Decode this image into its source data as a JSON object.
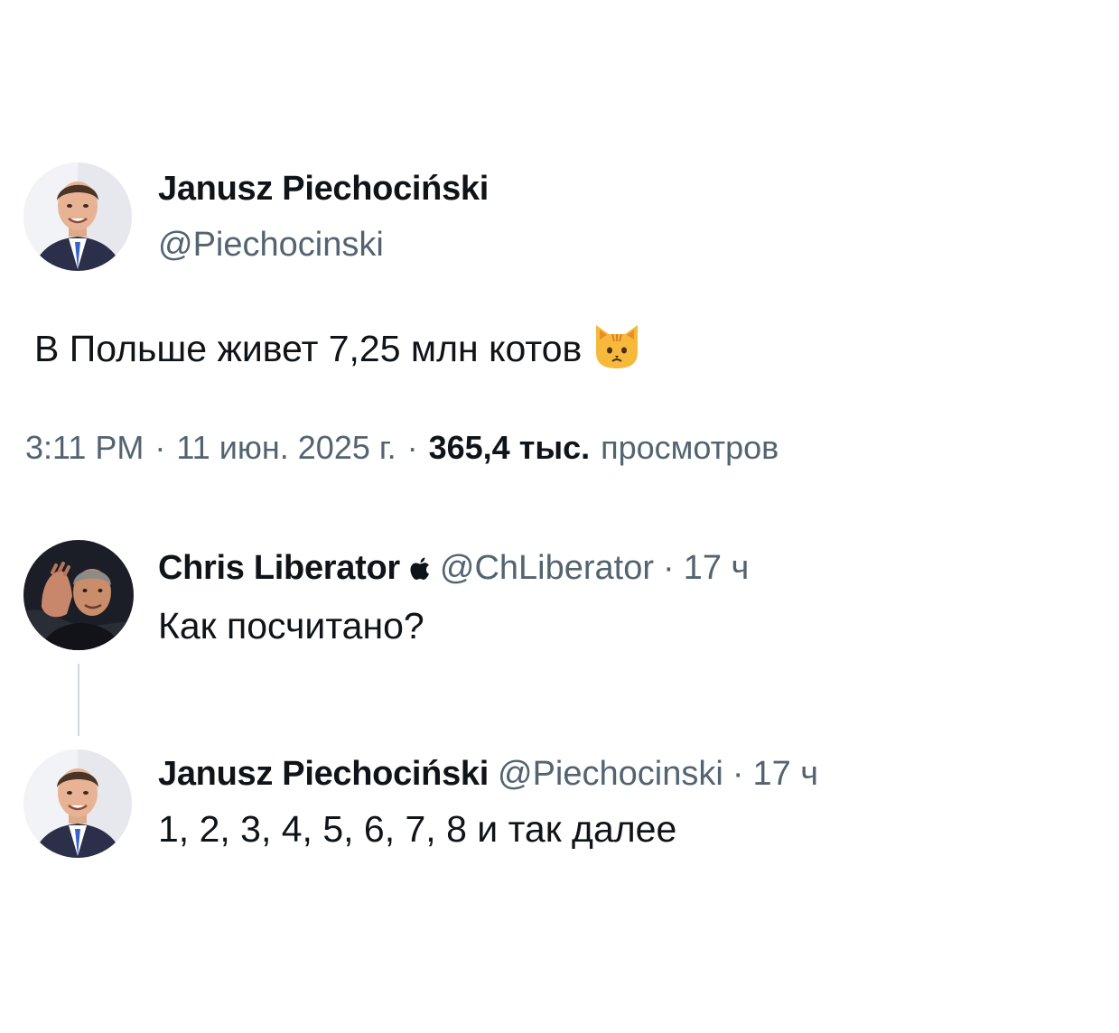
{
  "main_tweet": {
    "author_name": "Janusz Piechociński",
    "author_handle": "@Piechocinski",
    "text": "В Польше живет 7,25 млн котов",
    "emoji_icon": "cat-face-icon",
    "time": "3:11 PM",
    "separator": "·",
    "date": "11 июн. 2025 г.",
    "views_count": "365,4 тыс.",
    "views_label": "просмотров"
  },
  "replies": [
    {
      "author_name": "Chris Liberator",
      "badge_icon": "apple-icon",
      "author_handle": "@ChLiberator",
      "separator": "·",
      "time": "17 ч",
      "text": "Как посчитано?"
    },
    {
      "author_name": "Janusz Piechociński",
      "author_handle": "@Piechocinski",
      "separator": "·",
      "time": "17 ч",
      "text": "1, 2, 3, 4, 5, 6, 7, 8 и так далее"
    }
  ],
  "colors": {
    "text_primary": "#0f1419",
    "text_secondary": "#536471",
    "thread_line": "#cfd9de",
    "cat_emoji": "#f6b93b"
  }
}
